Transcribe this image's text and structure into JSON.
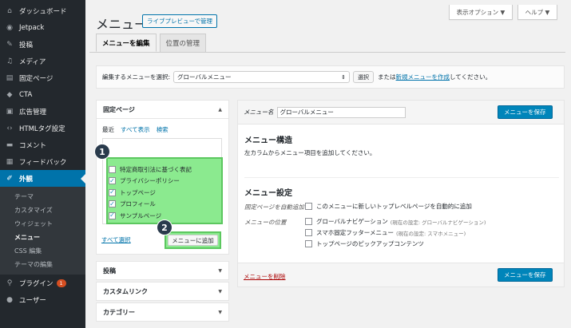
{
  "sidebar": {
    "items": [
      {
        "icon": "dashboard-icon",
        "glyph": "⌂",
        "label": "ダッシュボード"
      },
      {
        "icon": "jetpack-icon",
        "glyph": "◉",
        "label": "Jetpack"
      },
      {
        "icon": "pin-icon",
        "glyph": "✎",
        "label": "投稿"
      },
      {
        "icon": "media-icon",
        "glyph": "♫",
        "label": "メディア"
      },
      {
        "icon": "page-icon",
        "glyph": "▤",
        "label": "固定ページ"
      },
      {
        "icon": "cta-icon",
        "glyph": "◆",
        "label": "CTA"
      },
      {
        "icon": "ad-icon",
        "glyph": "▣",
        "label": "広告管理"
      },
      {
        "icon": "code-icon",
        "glyph": "‹›",
        "label": "HTMLタグ設定"
      },
      {
        "icon": "comment-icon",
        "glyph": "▬",
        "label": "コメント"
      },
      {
        "icon": "feedback-icon",
        "glyph": "▦",
        "label": "フィードバック"
      }
    ],
    "active": {
      "icon": "brush-icon",
      "glyph": "✐",
      "label": "外観"
    },
    "submenu": [
      "テーマ",
      "カスタマイズ",
      "ウィジェット",
      "メニュー",
      "CSS 編集",
      "テーマの編集"
    ],
    "after": [
      {
        "icon": "plugin-icon",
        "glyph": "⚲",
        "label": "プラグイン",
        "badge": "1"
      },
      {
        "icon": "user-icon",
        "glyph": "●",
        "label": "ユーザー"
      }
    ]
  },
  "top_buttons": {
    "display_options": "表示オプション ▼",
    "help": "ヘルプ ▼"
  },
  "header": {
    "title": "メニュー",
    "live_preview": "ライブプレビューで管理"
  },
  "tabs": [
    {
      "label": "メニューを編集"
    },
    {
      "label": "位置の管理"
    }
  ],
  "select_bar": {
    "label": "編集するメニューを選択:",
    "selected": "グローバルメニュー",
    "select_button": "選択",
    "or_text": "または",
    "create_link": "新規メニューを作成",
    "suffix": "してください。"
  },
  "left": {
    "fixed_page_title": "固定ページ",
    "subtabs": [
      "最近",
      "すべて表示",
      "検索"
    ],
    "pages": [
      {
        "label": "特定商取引法に基づく表記",
        "checked": false
      },
      {
        "label": "プライバシーポリシー",
        "checked": true
      },
      {
        "label": "トップページ",
        "checked": true
      },
      {
        "label": "プロフィール",
        "checked": true
      },
      {
        "label": "サンプルページ",
        "checked": true
      }
    ],
    "select_all": "すべて選択",
    "add_to_menu": "メニューに追加",
    "badge1": "1",
    "badge2": "2",
    "sections": [
      "投稿",
      "カスタムリンク",
      "カテゴリー"
    ]
  },
  "right": {
    "menu_name_label": "メニュー名",
    "menu_name_value": "グローバルメニュー",
    "save_button": "メニューを保存",
    "structure_title": "メニュー構造",
    "structure_desc": "左カラムからメニュー項目を追加してください。",
    "settings_title": "メニュー設定",
    "auto_add_label": "固定ページを自動追加",
    "auto_add_option": "このメニューに新しいトップレベルページを自動的に追加",
    "location_label": "メニューの位置",
    "locations": [
      {
        "label": "グローバルナビゲーション",
        "note": "(現在の設定: グローバルナビゲーション)"
      },
      {
        "label": "スマホ固定フッターメニュー",
        "note": "(現在の設定: スマホメニュー)"
      },
      {
        "label": "トップページのピックアップコンテンツ",
        "note": ""
      }
    ],
    "delete_link": "メニューを削除"
  },
  "colors": {
    "accent": "#0073aa",
    "highlight": "#8bea8f",
    "sidebar": "#23282d"
  }
}
